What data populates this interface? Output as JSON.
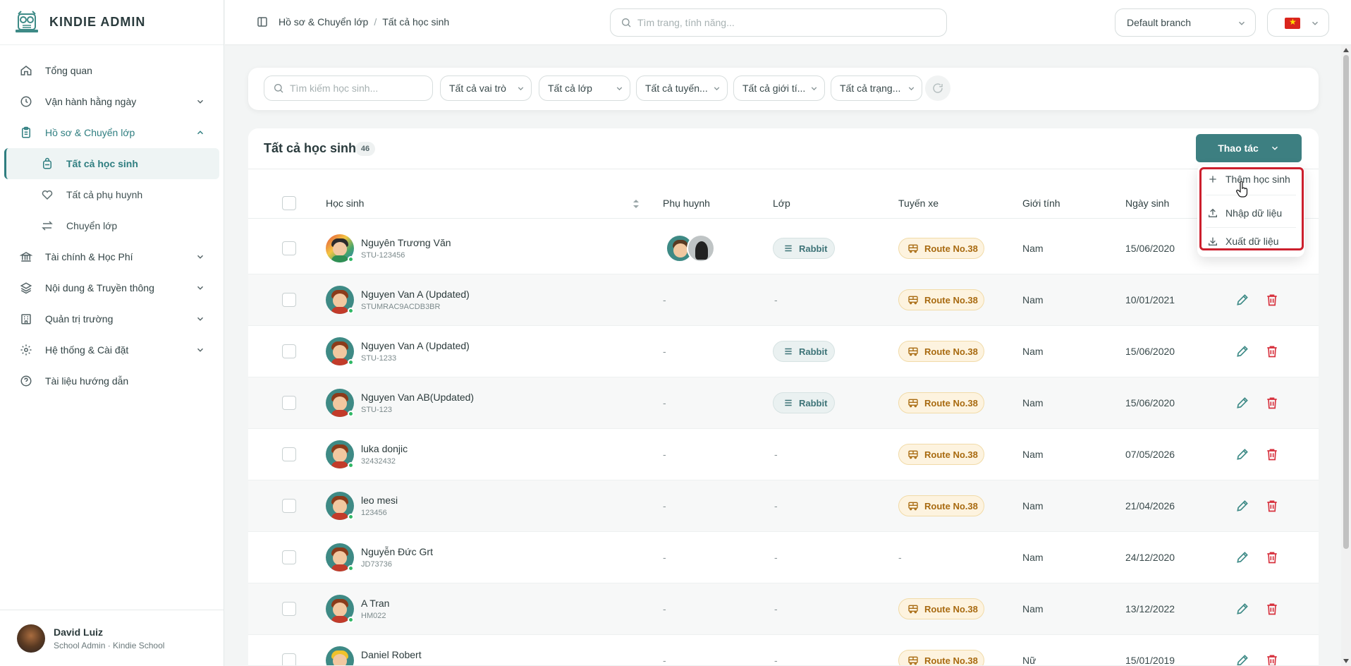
{
  "brand": {
    "name": "KINDIE ADMIN"
  },
  "nav": {
    "items": [
      {
        "label": "Tổng quan",
        "icon": "home-icon"
      },
      {
        "label": "Vận hành hằng ngày",
        "icon": "clock-icon"
      },
      {
        "label": "Hồ sơ & Chuyển lớp",
        "icon": "clipboard-icon"
      },
      {
        "label": "Tài chính & Học Phí",
        "icon": "bank-icon"
      },
      {
        "label": "Nội dung & Truyền thông",
        "icon": "layers-icon"
      },
      {
        "label": "Quản trị trường",
        "icon": "building-icon"
      },
      {
        "label": "Hệ thống & Cài đặt",
        "icon": "gear-icon"
      },
      {
        "label": "Tài liệu hướng dẫn",
        "icon": "help-icon"
      }
    ],
    "sub_items": [
      {
        "label": "Tất cả học sinh",
        "icon": "backpack-icon"
      },
      {
        "label": "Tất cả phụ huynh",
        "icon": "heart-hand-icon"
      },
      {
        "label": "Chuyển lớp",
        "icon": "swap-icon"
      }
    ]
  },
  "user": {
    "name": "David Luiz",
    "role": "School Admin · Kindie School"
  },
  "topbar": {
    "breadcrumb_parent": "Hồ sơ & Chuyển lớp",
    "breadcrumb_sep": "/",
    "breadcrumb_current": "Tất cả học sinh",
    "search_placeholder": "Tìm trang, tính năng...",
    "branch": "Default branch"
  },
  "filters": {
    "search_placeholder": "Tìm kiếm học sinh...",
    "roles": "Tất cả vai trò",
    "classes": "Tất cả lớp",
    "routes": "Tất cả tuyến...",
    "genders": "Tất cả giới tí...",
    "statuses": "Tất cả trạng..."
  },
  "panel": {
    "title": "Tất cả học sinh",
    "count": "46",
    "action_label": "Thao tác"
  },
  "dropdown": {
    "add": "Thêm học sinh",
    "import": "Nhập dữ liệu",
    "export": "Xuất dữ liệu"
  },
  "table": {
    "headers": {
      "student": "Học sinh",
      "parent": "Phụ huynh",
      "class": "Lớp",
      "route": "Tuyến xe",
      "gender": "Giới tính",
      "dob": "Ngày sinh"
    },
    "rows": [
      {
        "name": "Nguyên Trương Văn",
        "id": "STU-123456",
        "parent": "",
        "class": "Rabbit",
        "route": "Route No.38",
        "gender": "Nam",
        "dob": "15/06/2020"
      },
      {
        "name": "Nguyen Van A (Updated)",
        "id": "STUMRAC9ACDB3BR",
        "parent": "-",
        "class": "-",
        "route": "Route No.38",
        "gender": "Nam",
        "dob": "10/01/2021"
      },
      {
        "name": "Nguyen Van A (Updated)",
        "id": "STU-1233",
        "parent": "-",
        "class": "Rabbit",
        "route": "Route No.38",
        "gender": "Nam",
        "dob": "15/06/2020"
      },
      {
        "name": "Nguyen Van AB(Updated)",
        "id": "STU-123",
        "parent": "-",
        "class": "Rabbit",
        "route": "Route No.38",
        "gender": "Nam",
        "dob": "15/06/2020"
      },
      {
        "name": "luka donjic",
        "id": "32432432",
        "parent": "-",
        "class": "-",
        "route": "Route No.38",
        "gender": "Nam",
        "dob": "07/05/2026"
      },
      {
        "name": "leo mesi",
        "id": "123456",
        "parent": "-",
        "class": "-",
        "route": "Route No.38",
        "gender": "Nam",
        "dob": "21/04/2026"
      },
      {
        "name": "Nguyễn Đức Grt",
        "id": "JD73736",
        "parent": "-",
        "class": "-",
        "route": "-",
        "gender": "Nam",
        "dob": "24/12/2020"
      },
      {
        "name": "A Tran",
        "id": "HM022",
        "parent": "-",
        "class": "-",
        "route": "Route No.38",
        "gender": "Nam",
        "dob": "13/12/2022"
      },
      {
        "name": "Daniel Robert",
        "id": "",
        "parent": "-",
        "class": "-",
        "route": "Route No.38",
        "gender": "Nữ",
        "dob": "15/01/2019"
      }
    ]
  }
}
